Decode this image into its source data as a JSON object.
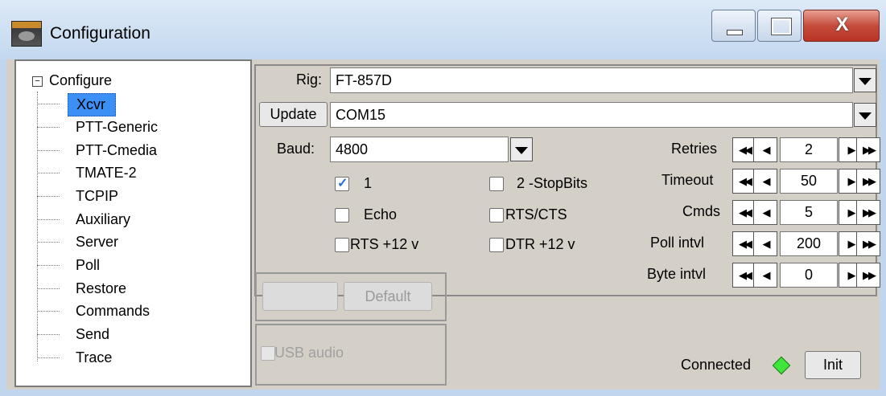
{
  "window": {
    "title": "Configuration",
    "close_glyph": "X"
  },
  "tree": {
    "root_label": "Configure",
    "root_expander": "−",
    "items": [
      {
        "label": "Xcvr",
        "selected": true
      },
      {
        "label": "PTT-Generic"
      },
      {
        "label": "PTT-Cmedia"
      },
      {
        "label": "TMATE-2"
      },
      {
        "label": "TCPIP"
      },
      {
        "label": "Auxiliary"
      },
      {
        "label": "Server"
      },
      {
        "label": "Poll"
      },
      {
        "label": "Restore"
      },
      {
        "label": "Commands"
      },
      {
        "label": "Send"
      },
      {
        "label": "Trace"
      }
    ]
  },
  "xcvr": {
    "rig_label": "Rig:",
    "rig_value": "FT-857D",
    "update_label": "Update",
    "port_value": "COM15",
    "baud_label": "Baud:",
    "baud_value": "4800",
    "check_1_label": "1",
    "check_1_checked": true,
    "check_2stop_label": "2 -StopBits",
    "check_echo_label": "Echo",
    "check_rtscts_label": "RTS/CTS",
    "check_rts12_label": "RTS +12 v",
    "check_dtr12_label": "DTR +12 v",
    "default_label": "Default",
    "usb_audio_label": "USB audio",
    "connected_label": "Connected",
    "connected_color": "#3ee639",
    "init_label": "Init",
    "counters": [
      {
        "label": "Retries",
        "value": "2"
      },
      {
        "label": "Timeout",
        "value": "50"
      },
      {
        "label": "Cmds",
        "value": "5"
      },
      {
        "label": "Poll intvl",
        "value": "200"
      },
      {
        "label": "Byte intvl",
        "value": "0"
      }
    ]
  }
}
